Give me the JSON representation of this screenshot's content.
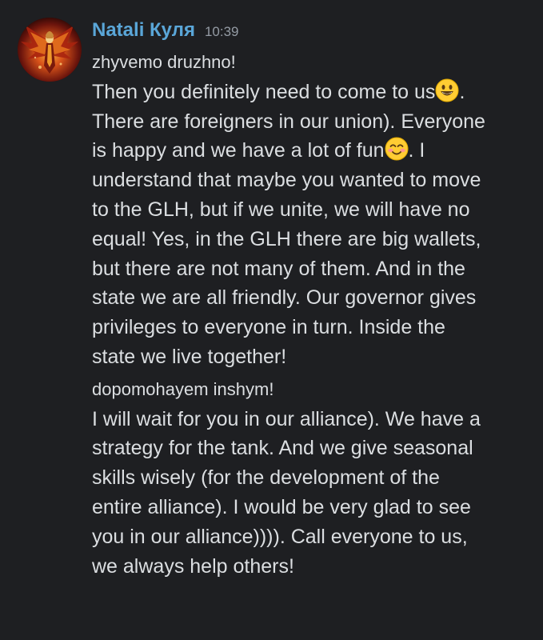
{
  "message": {
    "username": "Natali Куля",
    "timestamp": "10:39",
    "username_color": "#5aa6d8",
    "avatar_icon": "phoenix-avatar"
  },
  "lines": {
    "l1": "zhyvemo druzhno!",
    "l2a": "Then you definitely need to come to us",
    "l2b": ".",
    "l3": "There are foreigners in our union). Everyone",
    "l4a": "is happy and we have a lot of fun",
    "l4b": ". I",
    "l5": "understand that maybe you wanted to move",
    "l6": "to the GLH, but if we unite, we will have no",
    "l7": "equal! Yes, in the GLH there are big wallets,",
    "l8": "but there are not many of them. And in the",
    "l9": "state we are all friendly. Our governor gives",
    "l10": "privileges to everyone in turn. Inside the",
    "l11": "state we live together!",
    "l12": "dopomohayem inshym!",
    "l13": "I will wait for you in our alliance). We have a",
    "l14": "strategy for the tank. And we give seasonal",
    "l15": "skills wisely (for the development of the",
    "l16": "entire alliance). I would be very glad to see",
    "l17": "you in our alliance)))). Call everyone to us,",
    "l18": "we always help others!"
  },
  "emojis": {
    "first": "grinning-face-emoji",
    "second": "smiling-face-with-blush-emoji"
  }
}
